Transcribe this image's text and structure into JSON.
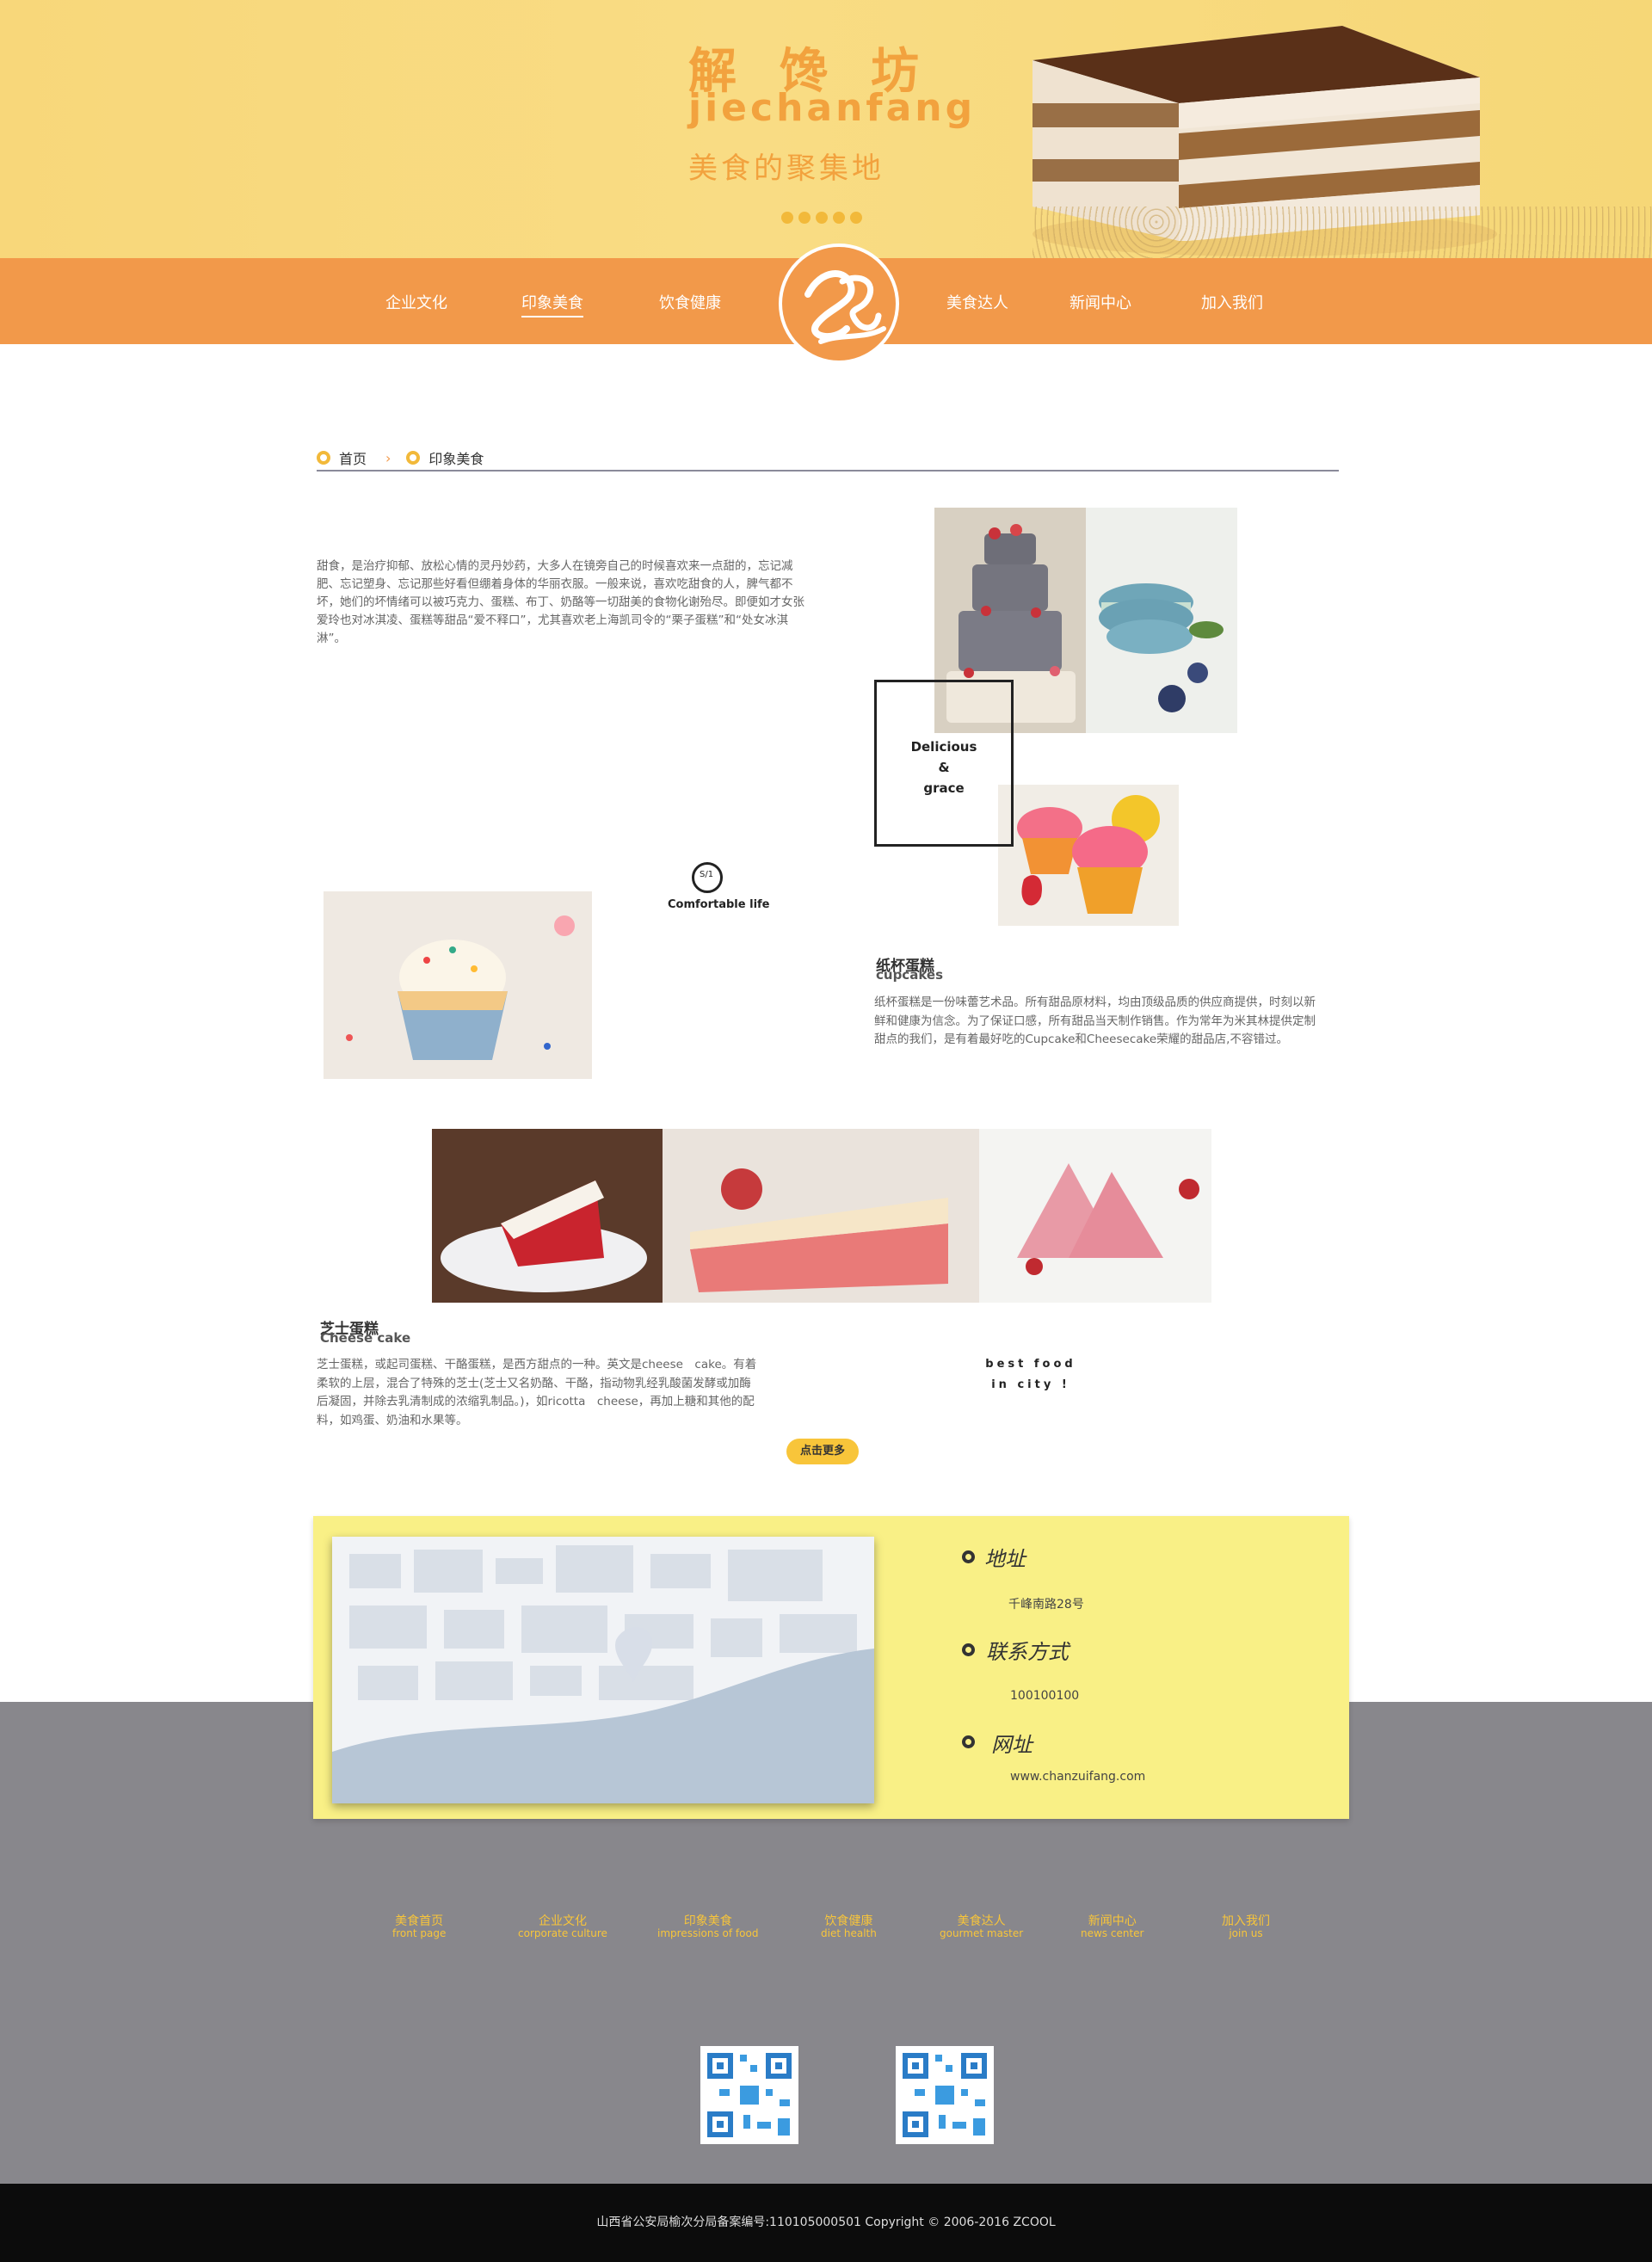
{
  "hero": {
    "title": "解馋坊",
    "subtitle": "jiechanfang",
    "tagline": "美食的聚集地"
  },
  "nav": {
    "items": [
      {
        "label": "企业文化"
      },
      {
        "label": "印象美食"
      },
      {
        "label": "饮食健康"
      },
      {
        "label": "美食达人"
      },
      {
        "label": "新闻中心"
      },
      {
        "label": "加入我们"
      }
    ],
    "active_index": 1
  },
  "breadcrumb": {
    "home": "首页",
    "current": "印象美食"
  },
  "intro": {
    "text": "甜食，是治疗抑郁、放松心情的灵丹妙药，大多人在镜旁自己的时候喜欢来一点甜的，忘记减肥、忘记塑身、忘记那些好看但绷着身体的华丽衣服。一般来说，喜欢吃甜食的人，脾气都不坏，她们的坏情绪可以被巧克力、蛋糕、布丁、奶酪等一切甜美的食物化谢殆尽。即便如才女张爱玲也对冰淇凌、蛋糕等甜品“爱不释口”，尤其喜欢老上海凯司令的“栗子蛋糕”和“处女冰淇淋”。"
  },
  "frame": {
    "line1": "Delicious",
    "line2": "&",
    "line3": "grace"
  },
  "comfort": {
    "label": "Comfortable life"
  },
  "cupcakes": {
    "title": "纸杯蛋糕",
    "subtitle": "cupcakes",
    "desc": "纸杯蛋糕是一份味蕾艺术品。所有甜品原材料，均由顶级品质的供应商提供，时刻以新鲜和健康为信念。为了保证口感，所有甜品当天制作销售。作为常年为米其林提供定制甜点的我们，是有着最好吃的Cupcake和Cheesecake荣耀的甜品店,不容错过。"
  },
  "cheesecake": {
    "title": "芝士蛋糕",
    "subtitle": "Cheese cake",
    "desc": "芝士蛋糕，或起司蛋糕、干酪蛋糕，是西方甜点的一种。英文是cheese　cake。有着柔软的上层，混合了特殊的芝士(芝士又名奶酪、干酪，指动物乳经乳酸菌发酵或加酶后凝固，并除去乳清制成的浓缩乳制品。)，如ricotta　cheese，再加上糖和其他的配料，如鸡蛋、奶油和水果等。"
  },
  "best_food": {
    "line1": "best food",
    "line2": "in city !"
  },
  "more_button": "点击更多",
  "contact": {
    "address_title": "地址",
    "address": "千峰南路28号",
    "phone_title": "联系方式",
    "phone": "100100100",
    "web_title": "网址",
    "web": "www.chanzuifang.com"
  },
  "footer_links": [
    {
      "cn": "美食首页",
      "en": "front page"
    },
    {
      "cn": "企业文化",
      "en": "corporate culture"
    },
    {
      "cn": "印象美食",
      "en": "impressions of food"
    },
    {
      "cn": "饮食健康",
      "en": "diet health"
    },
    {
      "cn": "美食达人",
      "en": "gourmet master"
    },
    {
      "cn": "新闻中心",
      "en": "news center"
    },
    {
      "cn": "加入我们",
      "en": "join us"
    }
  ],
  "copyright": "山西省公安局榆次分局备案编号:110105000501   Copyright © 2006-2016 ZCOOL",
  "colors": {
    "nav": "#f2994a",
    "hero": "#f8d77a",
    "accent": "#f8c53a",
    "contact_card": "#f9f086",
    "footer": "#88878c"
  }
}
